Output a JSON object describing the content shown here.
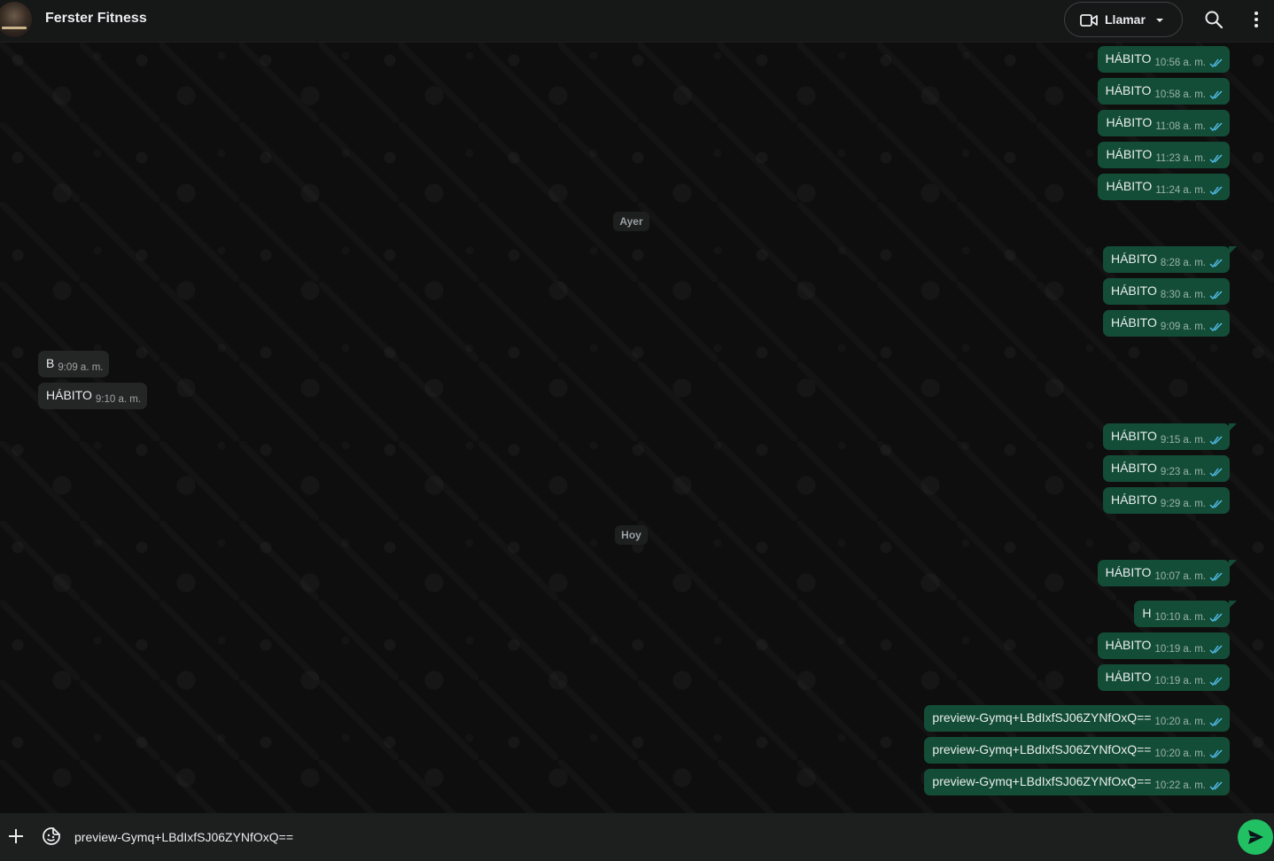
{
  "header": {
    "title": "Ferster Fitness",
    "call_label": "Llamar"
  },
  "dates": {
    "yesterday": "Ayer",
    "today": "Hoy"
  },
  "messages": [
    {
      "dir": "out",
      "text": "HÁBITO",
      "time": "10:56 a. m."
    },
    {
      "dir": "out",
      "text": "HÁBITO",
      "time": "10:58 a. m."
    },
    {
      "dir": "out",
      "text": "HÁBITO",
      "time": "11:08 a. m."
    },
    {
      "dir": "out",
      "text": "HÁBITO",
      "time": "11:23 a. m."
    },
    {
      "dir": "out",
      "text": "HÁBITO",
      "time": "11:24 a. m."
    },
    {
      "dir": "out",
      "text": "HÁBITO",
      "time": "8:28 a. m."
    },
    {
      "dir": "out",
      "text": "HÁBITO",
      "time": "8:30 a. m."
    },
    {
      "dir": "out",
      "text": "HÁBITO",
      "time": "9:09 a. m."
    },
    {
      "dir": "in",
      "text": "B",
      "time": "9:09 a. m."
    },
    {
      "dir": "in",
      "text": "HÁBITO",
      "time": "9:10 a. m."
    },
    {
      "dir": "out",
      "text": "HÁBITO",
      "time": "9:15 a. m."
    },
    {
      "dir": "out",
      "text": "HÁBITO",
      "time": "9:23 a. m."
    },
    {
      "dir": "out",
      "text": "HÁBITO",
      "time": "9:29 a. m."
    },
    {
      "dir": "out",
      "text": "HÁBITO",
      "time": "10:07 a. m."
    },
    {
      "dir": "out",
      "text": "H",
      "time": "10:10 a. m."
    },
    {
      "dir": "out",
      "text": "HÀBITO",
      "time": "10:19 a. m."
    },
    {
      "dir": "out",
      "text": "HÁBITO",
      "time": "10:19 a. m."
    },
    {
      "dir": "out",
      "text": "preview-Gymq+LBdIxfSJ06ZYNfOxQ==",
      "time": "10:20 a. m."
    },
    {
      "dir": "out",
      "text": "preview-Gymq+LBdIxfSJ06ZYNfOxQ==",
      "time": "10:20 a. m."
    },
    {
      "dir": "out",
      "text": "preview-Gymq+LBdIxfSJ06ZYNfOxQ==",
      "time": "10:22 a. m."
    }
  ],
  "composer": {
    "value": "preview-Gymq+LBdIxfSJ06ZYNfOxQ=="
  },
  "colors": {
    "outgoing_bubble": "#144d37",
    "incoming_bubble": "#242626",
    "read_ticks": "#53bdeb",
    "send_button": "#21c063"
  },
  "icons": {
    "video": "video-camera-icon",
    "caret": "chevron-down-icon",
    "search": "search-icon",
    "menu": "more-vertical-icon",
    "plus": "plus-icon",
    "sticker": "sticker-icon",
    "send": "send-icon",
    "ticks": "double-check-icon"
  }
}
